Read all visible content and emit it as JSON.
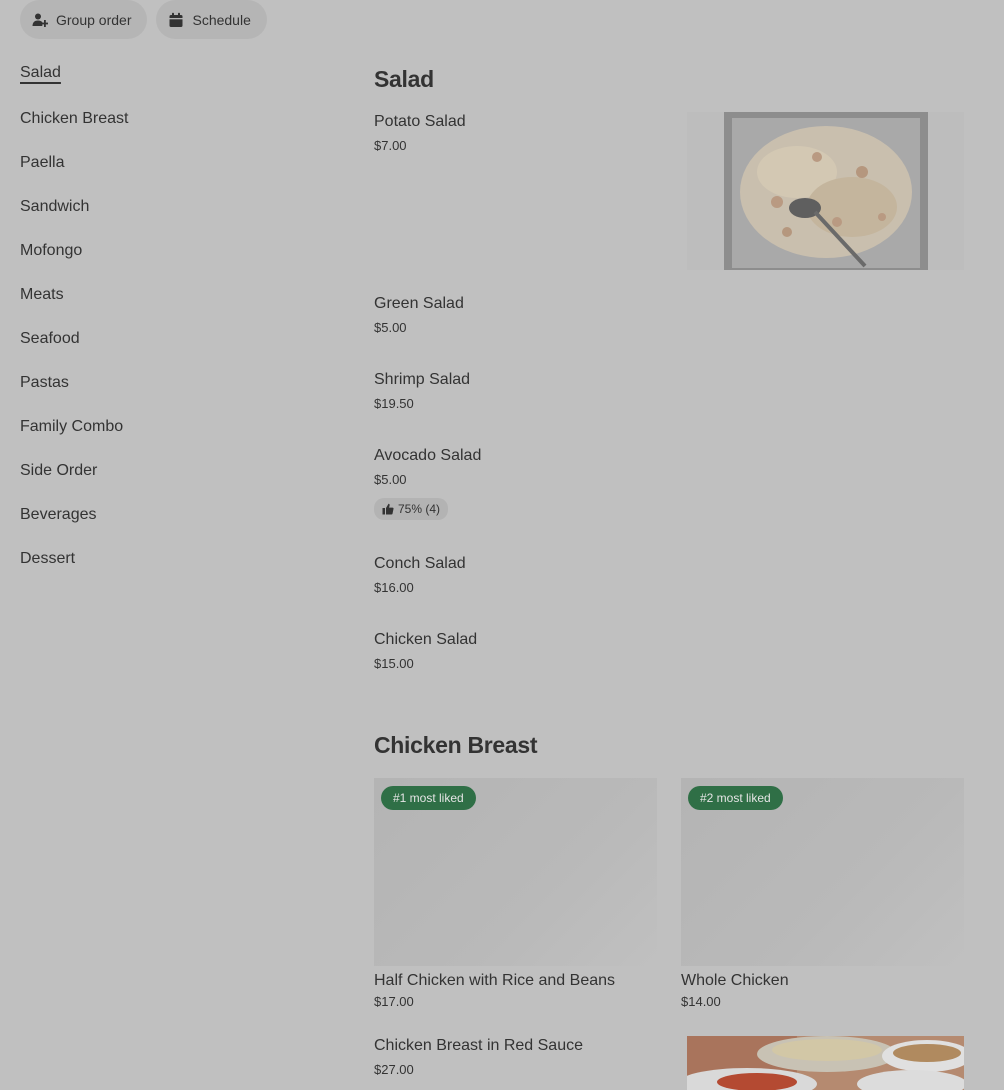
{
  "toolbar": {
    "group_order_label": "Group order",
    "schedule_label": "Schedule"
  },
  "sidebar": {
    "items": [
      {
        "label": "Salad"
      },
      {
        "label": "Chicken Breast"
      },
      {
        "label": "Paella"
      },
      {
        "label": "Sandwich"
      },
      {
        "label": "Mofongo"
      },
      {
        "label": "Meats"
      },
      {
        "label": "Seafood"
      },
      {
        "label": "Pastas"
      },
      {
        "label": "Family Combo"
      },
      {
        "label": "Side Order"
      },
      {
        "label": "Beverages"
      },
      {
        "label": "Dessert"
      }
    ]
  },
  "salad": {
    "title": "Salad",
    "items": [
      {
        "name": "Potato Salad",
        "price": "$7.00"
      },
      {
        "name": "Green Salad",
        "price": "$5.00"
      },
      {
        "name": "Shrimp Salad",
        "price": "$19.50"
      },
      {
        "name": "Avocado Salad",
        "price": "$5.00",
        "rating": "75% (4)"
      },
      {
        "name": "Conch Salad",
        "price": "$16.00"
      },
      {
        "name": "Chicken Salad",
        "price": "$15.00"
      }
    ]
  },
  "chicken_breast": {
    "title": "Chicken Breast",
    "cards": [
      {
        "badge": "#1 most liked",
        "name": "Half Chicken with Rice and Beans",
        "price": "$17.00"
      },
      {
        "badge": "#2 most liked",
        "name": "Whole Chicken",
        "price": "$14.00"
      }
    ],
    "items": [
      {
        "name": "Chicken Breast in Red Sauce",
        "price": "$27.00"
      }
    ]
  },
  "icons": {
    "group_order": "add-person-icon",
    "schedule": "calendar-icon",
    "rating": "thumbs-up-icon"
  },
  "colors": {
    "badge": "#2f6f46",
    "background": "#c0c0c0"
  }
}
